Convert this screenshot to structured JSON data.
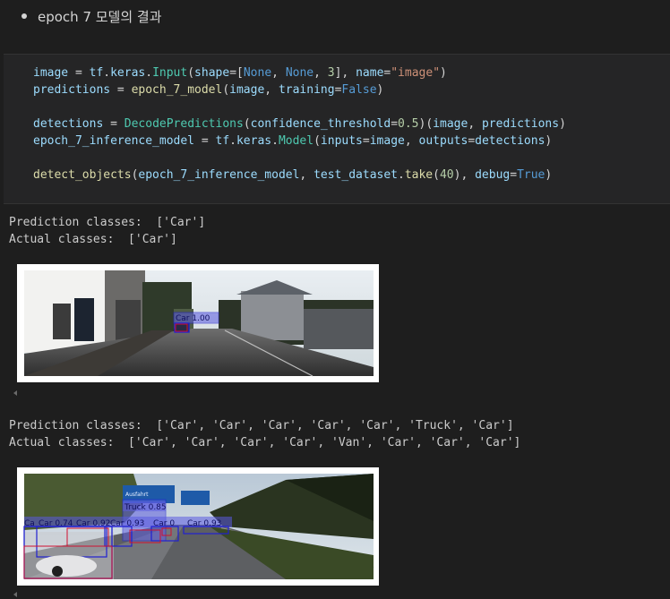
{
  "markdown": {
    "bullet_text": "epoch 7 모델의 결과"
  },
  "colors": {
    "background": "#1e1e1e",
    "cell": "#252526",
    "box_blue": "#2020d0",
    "box_red": "#d01030"
  },
  "code_lines": [
    [
      [
        "v",
        "image"
      ],
      [
        "p",
        " = "
      ],
      [
        "v",
        "tf"
      ],
      [
        "p",
        "."
      ],
      [
        "v",
        "keras"
      ],
      [
        "p",
        "."
      ],
      [
        "c",
        "Input"
      ],
      [
        "p",
        "("
      ],
      [
        "v",
        "shape"
      ],
      [
        "p",
        "=["
      ],
      [
        "k",
        "None"
      ],
      [
        "p",
        ", "
      ],
      [
        "k",
        "None"
      ],
      [
        "p",
        ", "
      ],
      [
        "n",
        "3"
      ],
      [
        "p",
        "], "
      ],
      [
        "v",
        "name"
      ],
      [
        "p",
        "="
      ],
      [
        "s",
        "\"image\""
      ],
      [
        "p",
        ")"
      ]
    ],
    [
      [
        "v",
        "predictions"
      ],
      [
        "p",
        " = "
      ],
      [
        "f",
        "epoch_7_model"
      ],
      [
        "p",
        "("
      ],
      [
        "v",
        "image"
      ],
      [
        "p",
        ", "
      ],
      [
        "v",
        "training"
      ],
      [
        "p",
        "="
      ],
      [
        "k",
        "False"
      ],
      [
        "p",
        ")"
      ]
    ],
    [],
    [
      [
        "v",
        "detections"
      ],
      [
        "p",
        " = "
      ],
      [
        "c",
        "DecodePredictions"
      ],
      [
        "p",
        "("
      ],
      [
        "v",
        "confidence_threshold"
      ],
      [
        "p",
        "="
      ],
      [
        "n",
        "0.5"
      ],
      [
        "p",
        ")("
      ],
      [
        "v",
        "image"
      ],
      [
        "p",
        ", "
      ],
      [
        "v",
        "predictions"
      ],
      [
        "p",
        ")"
      ]
    ],
    [
      [
        "v",
        "epoch_7_inference_model"
      ],
      [
        "p",
        " = "
      ],
      [
        "v",
        "tf"
      ],
      [
        "p",
        "."
      ],
      [
        "v",
        "keras"
      ],
      [
        "p",
        "."
      ],
      [
        "c",
        "Model"
      ],
      [
        "p",
        "("
      ],
      [
        "v",
        "inputs"
      ],
      [
        "p",
        "="
      ],
      [
        "v",
        "image"
      ],
      [
        "p",
        ", "
      ],
      [
        "v",
        "outputs"
      ],
      [
        "p",
        "="
      ],
      [
        "v",
        "detections"
      ],
      [
        "p",
        ")"
      ]
    ],
    [],
    [
      [
        "f",
        "detect_objects"
      ],
      [
        "p",
        "("
      ],
      [
        "v",
        "epoch_7_inference_model"
      ],
      [
        "p",
        ", "
      ],
      [
        "v",
        "test_dataset"
      ],
      [
        "p",
        "."
      ],
      [
        "f",
        "take"
      ],
      [
        "p",
        "("
      ],
      [
        "n",
        "40"
      ],
      [
        "p",
        "), "
      ],
      [
        "v",
        "debug"
      ],
      [
        "p",
        "="
      ],
      [
        "k",
        "True"
      ],
      [
        "p",
        ")"
      ]
    ]
  ],
  "output1": {
    "prediction": "Prediction classes:  ['Car']",
    "actual": "Actual classes:  ['Car']",
    "image": {
      "label_car": "Car 1.00"
    }
  },
  "output2": {
    "prediction": "Prediction classes:  ['Car', 'Car', 'Car', 'Car', 'Car', 'Truck', 'Car']",
    "actual": "Actual classes:  ['Car', 'Car', 'Car', 'Car', 'Van', 'Car', 'Car', 'Car']",
    "image": {
      "label_truck": "Truck 0.85",
      "label_1": "Car 0.74",
      "label_2": "Car 0.92",
      "label_3": "Car 0.93",
      "label_4": "Car 0",
      "label_5": "Car 0.93",
      "label_edge": "Ca",
      "sign_text": "Ausfahrt"
    }
  }
}
